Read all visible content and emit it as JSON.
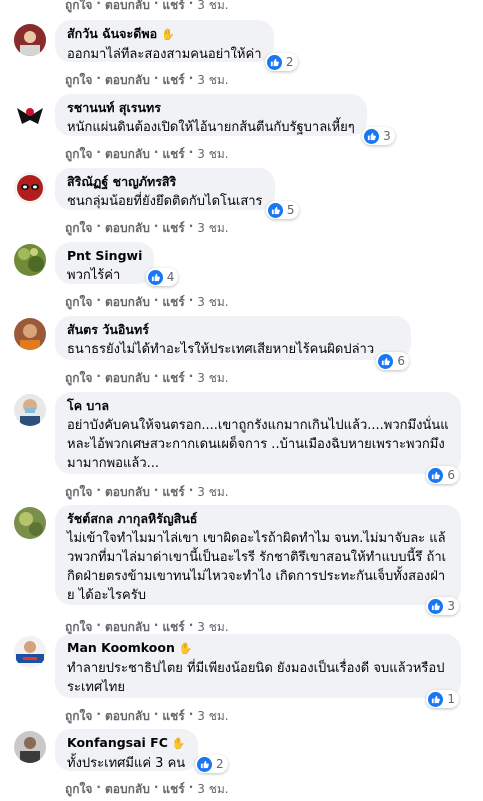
{
  "actions": {
    "like": "ถูกใจ",
    "reply": "ตอบกลับ",
    "share": "แชร์",
    "sep": "·"
  },
  "wave_icon": "waving-hand-icon",
  "accent": "#1877f2",
  "top_row": {
    "time": "3 ชม."
  },
  "comments": [
    {
      "name": "สักวัน ฉันจะดีพอ",
      "text": "ออกมาไล่ทีละสองสามคนอย่าให้ค่า",
      "reactions": "2",
      "time": "3 ชม.",
      "wave": true
    },
    {
      "name": "รชานนท์ สุเรนทร",
      "text": "หนักแผ่นดินต้องเปิดให้ไอ้นายกส้นตีนกับรัฐบาลเหี้ยๆ",
      "reactions": "3",
      "time": "3 ชม.",
      "wave": false
    },
    {
      "name": "สิริณัฏฐ์ ชาญภัทรสิริ",
      "text": "ชนกลุ่มน้อยที่ยังยึดติดกับไดโนเสาร",
      "reactions": "5",
      "time": "3 ชม.",
      "wave": false
    },
    {
      "name": "Pnt Singwi",
      "text": "พวกไร้ค่า",
      "reactions": "4",
      "time": "3 ชม.",
      "wave": false
    },
    {
      "name": "สันตร วันอินทร์",
      "text": "ธนาธรยังไม่ได้ทำอะไรให้ประเทศเสียหายไร้คนผิดปล่าว",
      "reactions": "6",
      "time": "3 ชม.",
      "wave": false
    },
    {
      "name": "โค บาล",
      "text": "อย่าบังคับคนให้จนตรอก....เขาถูกรังแกมากเกินไปแล้ว....พวกมึงนั่นแหละไอ้พวกเศษสวะกากเดนเผด็จการ ..บ้านเมืองฉิบหายเพราะพวกมึงมามากพอแล้ว...",
      "reactions": "6",
      "time": "3 ชม.",
      "wave": false
    },
    {
      "name": "รัชต์สกล ภากุลหิรัญสินธ์",
      "text": "ไม่เข้าใจทำไมมาไล่เขา เขาผิดอะไรถ้าผิดทำไม จนท.ไม่มาจับละ แล้วพวกที่มาไล่มาด่าเขานี้เป็นอะไรรี รักชาติรึเขาสอนให้ทำแบบนี้รึ ถ้าเกิดฝ่ายตรงข้ามเขาทนไม่ไหวจะทำไง เกิดการประทะกันเจ็บทั้งสองฝ่าย ได้อะไรครับ",
      "reactions": "3",
      "time": "3 ชม.",
      "wave": false
    },
    {
      "name": "Man Koomkoon",
      "text": "ทำลายประชาธิปไตย ที่มีเพียงน้อยนิด ยังมองเป็นเรื่องดี จบแล้วหรือประเทศไทย",
      "reactions": "1",
      "time": "3 ชม.",
      "wave": true
    },
    {
      "name": "Konfangsai FC",
      "text": "ทั้งประเทศมีแค่ 3 คน",
      "reactions": "2",
      "time": "3 ชม.",
      "wave": true
    }
  ]
}
